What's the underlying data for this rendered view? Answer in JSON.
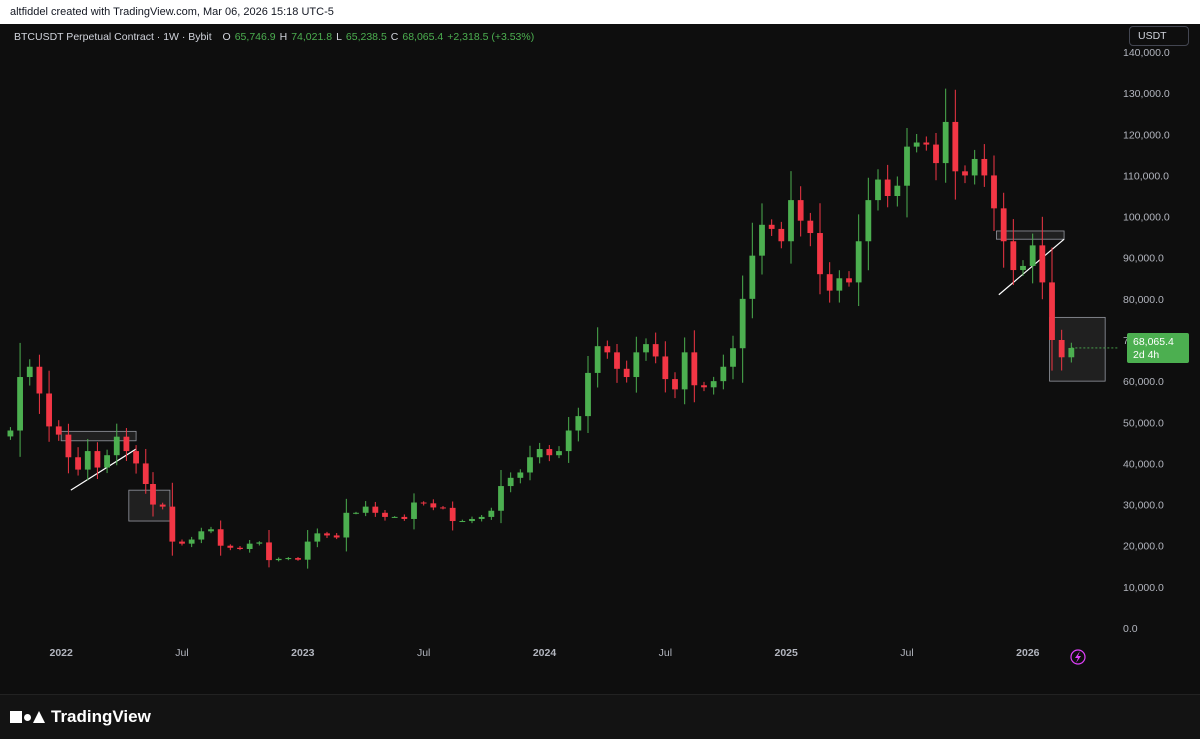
{
  "header": {
    "attribution": "altfiddel created with TradingView.com, Mar 06, 2026 15:18 UTC-5"
  },
  "legend": {
    "symbol": "BTCUSDT Perpetual Contract · 1W · Bybit",
    "o_label": "O",
    "o_value": "65,746.9",
    "h_label": "H",
    "h_value": "74,021.8",
    "l_label": "L",
    "l_value": "65,238.5",
    "c_label": "C",
    "c_value": "68,065.4",
    "change": "+2,318.5 (+3.53%)"
  },
  "currency_button": "USDT",
  "price_label": {
    "price": "68,065.4",
    "countdown": "2d 4h"
  },
  "footer": {
    "brand": "TradingView"
  },
  "colors": {
    "up": "#4caf50",
    "down": "#f23645",
    "background": "#0e0e0e",
    "text": "#b2b5be"
  },
  "icons": {
    "alert": "lightning-alert-icon"
  },
  "chart_data": {
    "type": "candlestick",
    "title": "BTCUSDT Perpetual Contract · 1W · Bybit",
    "ylim": [
      0,
      140000
    ],
    "y_ticks": [
      0,
      10000,
      20000,
      30000,
      40000,
      50000,
      60000,
      70000,
      80000,
      90000,
      100000,
      110000,
      120000,
      130000,
      140000
    ],
    "y_tick_labels": [
      "0.0",
      "10,000.0",
      "20,000.0",
      "30,000.0",
      "40,000.0",
      "50,000.0",
      "60,000.0",
      "70,000.0",
      "80,000.0",
      "90,000.0",
      "100,000.0",
      "110,000.0",
      "120,000.0",
      "130,000.0",
      "140,000.0"
    ],
    "xlim": [
      2021.78,
      2026.34
    ],
    "x_ticks": [
      {
        "label": "2022",
        "t": 2022.0
      },
      {
        "label": "Jul",
        "t": 2022.5
      },
      {
        "label": "2023",
        "t": 2023.0
      },
      {
        "label": "Jul",
        "t": 2023.5
      },
      {
        "label": "2024",
        "t": 2024.0
      },
      {
        "label": "Jul",
        "t": 2024.5
      },
      {
        "label": "2025",
        "t": 2025.0
      },
      {
        "label": "Jul",
        "t": 2025.5
      },
      {
        "label": "2026",
        "t": 2026.0
      }
    ],
    "grid": false,
    "series_closes": [
      [
        2021.79,
        48000
      ],
      [
        2021.83,
        61000
      ],
      [
        2021.87,
        63500
      ],
      [
        2021.91,
        57000
      ],
      [
        2021.95,
        49000
      ],
      [
        2021.99,
        47000
      ],
      [
        2022.03,
        41500
      ],
      [
        2022.07,
        38500
      ],
      [
        2022.11,
        43000
      ],
      [
        2022.15,
        39000
      ],
      [
        2022.19,
        42000
      ],
      [
        2022.23,
        46500
      ],
      [
        2022.27,
        43000
      ],
      [
        2022.31,
        40000
      ],
      [
        2022.35,
        35000
      ],
      [
        2022.38,
        30000
      ],
      [
        2022.42,
        29500
      ],
      [
        2022.46,
        21000
      ],
      [
        2022.5,
        20500
      ],
      [
        2022.54,
        21500
      ],
      [
        2022.58,
        23500
      ],
      [
        2022.62,
        24000
      ],
      [
        2022.66,
        20000
      ],
      [
        2022.7,
        19500
      ],
      [
        2022.74,
        19200
      ],
      [
        2022.78,
        20500
      ],
      [
        2022.82,
        20800
      ],
      [
        2022.86,
        16500
      ],
      [
        2022.9,
        16800
      ],
      [
        2022.94,
        17000
      ],
      [
        2022.98,
        16600
      ],
      [
        2023.02,
        21000
      ],
      [
        2023.06,
        23000
      ],
      [
        2023.1,
        22500
      ],
      [
        2023.14,
        22000
      ],
      [
        2023.18,
        28000
      ],
      [
        2023.22,
        28000
      ],
      [
        2023.26,
        29500
      ],
      [
        2023.3,
        28000
      ],
      [
        2023.34,
        27000
      ],
      [
        2023.38,
        27000
      ],
      [
        2023.42,
        26500
      ],
      [
        2023.46,
        30500
      ],
      [
        2023.5,
        30300
      ],
      [
        2023.54,
        29300
      ],
      [
        2023.58,
        29200
      ],
      [
        2023.62,
        26000
      ],
      [
        2023.66,
        26000
      ],
      [
        2023.7,
        26500
      ],
      [
        2023.74,
        27000
      ],
      [
        2023.78,
        28500
      ],
      [
        2023.82,
        34500
      ],
      [
        2023.86,
        36500
      ],
      [
        2023.9,
        37800
      ],
      [
        2023.94,
        41500
      ],
      [
        2023.98,
        43500
      ],
      [
        2024.02,
        42000
      ],
      [
        2024.06,
        43000
      ],
      [
        2024.1,
        48000
      ],
      [
        2024.14,
        51500
      ],
      [
        2024.18,
        62000
      ],
      [
        2024.22,
        68500
      ],
      [
        2024.26,
        67000
      ],
      [
        2024.3,
        63000
      ],
      [
        2024.34,
        61000
      ],
      [
        2024.38,
        67000
      ],
      [
        2024.42,
        69000
      ],
      [
        2024.46,
        66000
      ],
      [
        2024.5,
        60500
      ],
      [
        2024.54,
        58000
      ],
      [
        2024.58,
        67000
      ],
      [
        2024.62,
        59000
      ],
      [
        2024.66,
        58500
      ],
      [
        2024.7,
        60000
      ],
      [
        2024.74,
        63500
      ],
      [
        2024.78,
        68000
      ],
      [
        2024.82,
        80000
      ],
      [
        2024.86,
        90500
      ],
      [
        2024.9,
        98000
      ],
      [
        2024.94,
        97000
      ],
      [
        2024.98,
        94000
      ],
      [
        2025.02,
        104000
      ],
      [
        2025.06,
        99000
      ],
      [
        2025.1,
        96000
      ],
      [
        2025.14,
        86000
      ],
      [
        2025.18,
        82000
      ],
      [
        2025.22,
        85000
      ],
      [
        2025.26,
        84000
      ],
      [
        2025.3,
        94000
      ],
      [
        2025.34,
        104000
      ],
      [
        2025.38,
        109000
      ],
      [
        2025.42,
        105000
      ],
      [
        2025.46,
        107500
      ],
      [
        2025.5,
        117000
      ],
      [
        2025.54,
        118000
      ],
      [
        2025.58,
        117500
      ],
      [
        2025.62,
        113000
      ],
      [
        2025.66,
        123000
      ],
      [
        2025.7,
        111000
      ],
      [
        2025.74,
        110000
      ],
      [
        2025.78,
        114000
      ],
      [
        2025.82,
        110000
      ],
      [
        2025.86,
        102000
      ],
      [
        2025.9,
        94000
      ],
      [
        2025.94,
        87000
      ],
      [
        2025.98,
        88000
      ],
      [
        2026.02,
        93000
      ],
      [
        2026.06,
        84000
      ],
      [
        2026.1,
        70000
      ],
      [
        2026.14,
        65800
      ],
      [
        2026.18,
        68065
      ]
    ],
    "annotations": [
      {
        "label": "resistance-zone-2022"
      },
      {
        "label": "breakdown-zone-2022"
      },
      {
        "label": "resistance-zone-2025"
      },
      {
        "label": "breakdown-zone-2026"
      }
    ]
  }
}
